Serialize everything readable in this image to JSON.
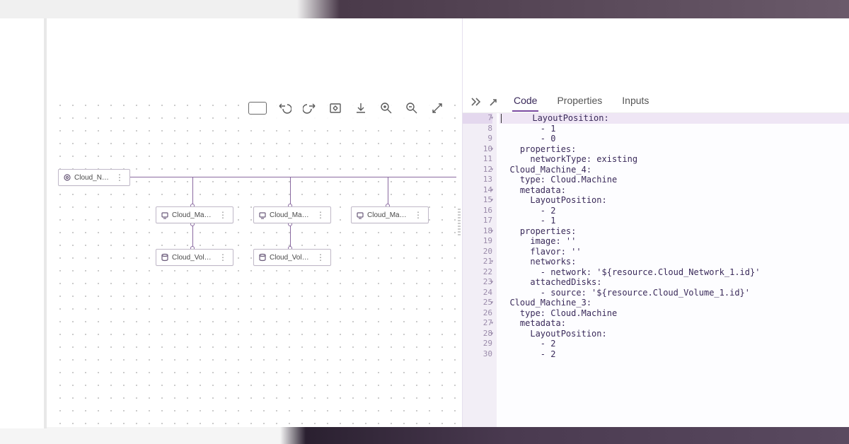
{
  "toolbar_icons": {
    "keyboard": "keyboard",
    "undo": "undo",
    "redo": "redo",
    "fit": "fit-to-screen",
    "download": "download",
    "zoom_in": "zoom-in",
    "zoom_out": "zoom-out",
    "expand": "expand"
  },
  "nodes": {
    "network": {
      "label": "Cloud_Networ..."
    },
    "machine1": {
      "label": "Cloud_Machin..."
    },
    "machine2": {
      "label": "Cloud_Machin..."
    },
    "machine3": {
      "label": "Cloud_Machin..."
    },
    "volume1": {
      "label": "Cloud_Volume..."
    },
    "volume2": {
      "label": "Cloud_Volume..."
    }
  },
  "node_menu_glyph": "⋮",
  "panel": {
    "tabs": {
      "code": "Code",
      "properties": "Properties",
      "inputs": "Inputs"
    }
  },
  "code": {
    "lines": [
      {
        "n": "7",
        "fold": true,
        "cur": true,
        "text": "      LayoutPosition:"
      },
      {
        "n": "8",
        "fold": false,
        "text": "        - 1"
      },
      {
        "n": "9",
        "fold": false,
        "text": "        - 0"
      },
      {
        "n": "10",
        "fold": true,
        "text": "    properties:"
      },
      {
        "n": "11",
        "fold": false,
        "text": "      networkType: existing"
      },
      {
        "n": "12",
        "fold": true,
        "text": "  Cloud_Machine_4:"
      },
      {
        "n": "13",
        "fold": false,
        "text": "    type: Cloud.Machine"
      },
      {
        "n": "14",
        "fold": true,
        "text": "    metadata:"
      },
      {
        "n": "15",
        "fold": true,
        "text": "      LayoutPosition:"
      },
      {
        "n": "16",
        "fold": false,
        "text": "        - 2"
      },
      {
        "n": "17",
        "fold": false,
        "text": "        - 1"
      },
      {
        "n": "18",
        "fold": true,
        "text": "    properties:"
      },
      {
        "n": "19",
        "fold": false,
        "text": "      image: ''"
      },
      {
        "n": "20",
        "fold": false,
        "text": "      flavor: ''"
      },
      {
        "n": "21",
        "fold": true,
        "text": "      networks:"
      },
      {
        "n": "22",
        "fold": false,
        "text": "        - network: '${resource.Cloud_Network_1.id}'"
      },
      {
        "n": "23",
        "fold": true,
        "text": "      attachedDisks:"
      },
      {
        "n": "24",
        "fold": false,
        "text": "        - source: '${resource.Cloud_Volume_1.id}'"
      },
      {
        "n": "25",
        "fold": true,
        "text": "  Cloud_Machine_3:"
      },
      {
        "n": "26",
        "fold": false,
        "text": "    type: Cloud.Machine"
      },
      {
        "n": "27",
        "fold": true,
        "text": "    metadata:"
      },
      {
        "n": "28",
        "fold": true,
        "text": "      LayoutPosition:"
      },
      {
        "n": "29",
        "fold": false,
        "text": "        - 2"
      },
      {
        "n": "30",
        "fold": false,
        "text": "        - 2"
      }
    ]
  }
}
